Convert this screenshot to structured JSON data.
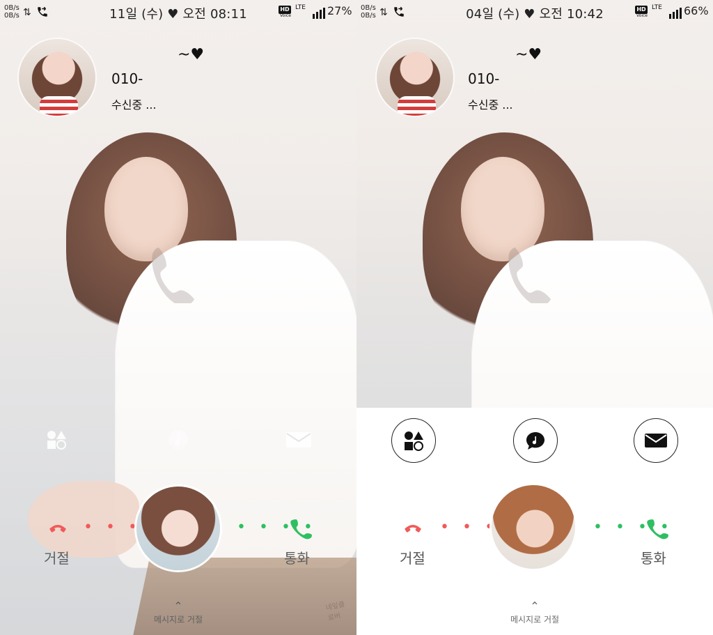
{
  "screens": [
    {
      "status": {
        "net_up": "0B/s",
        "net_down": "0B/s",
        "date_time": "11일 (수) ♥ 오전 08:11",
        "hd": "HD",
        "voice": "Voice",
        "lte": "LTE",
        "battery": "27%"
      },
      "caller": {
        "nickname_suffix": "~♥",
        "number": "010-",
        "state": "수신중 ..."
      },
      "actions": {
        "decline_label": "거절",
        "accept_label": "통화",
        "dots": "• • • •",
        "reject_with_message": "메시지로 거절",
        "reject_chevron": "⌃"
      },
      "watermark": "네잎클로버"
    },
    {
      "status": {
        "net_up": "0B/s",
        "net_down": "0B/s",
        "date_time": "04일 (수) ♥ 오전 10:42",
        "hd": "HD",
        "voice": "Voice",
        "lte": "LTE",
        "battery": "66%"
      },
      "caller": {
        "nickname_suffix": "~♥",
        "number": "010-",
        "state": "수신중 ..."
      },
      "actions": {
        "decline_label": "거절",
        "accept_label": "통화",
        "dots": "• • • •",
        "reject_with_message": "메시지로 거절",
        "reject_chevron": "⌃"
      }
    }
  ],
  "colors": {
    "decline": "#f05a5a",
    "accept": "#2fbf62",
    "text": "#111111",
    "label_gray": "#5f5f5f"
  }
}
